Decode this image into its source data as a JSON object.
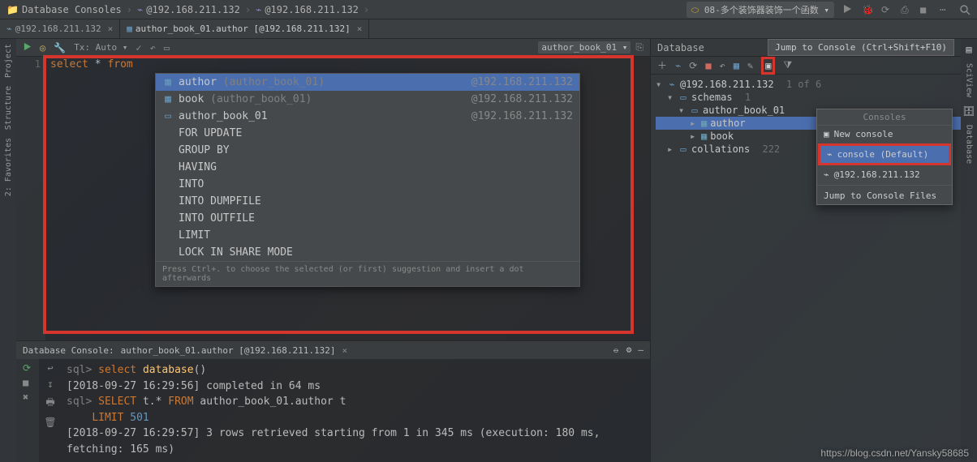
{
  "breadcrumbs": {
    "root": "Database Consoles",
    "item1": "@192.168.211.132",
    "item2": "@192.168.211.132"
  },
  "runConfig": "08-多个装饰器装饰一个函数",
  "tabs": {
    "tab1": "@192.168.211.132",
    "tab2": "author_book_01.author [@192.168.211.132]"
  },
  "editorToolbar": {
    "txMode": "Tx: Auto",
    "schema": "author_book_01"
  },
  "editor": {
    "lineNum": "1",
    "code": {
      "select": "select",
      "star": "*",
      "from": "from"
    }
  },
  "completion": {
    "rows": [
      {
        "label": "author",
        "dim": "(author_book_01)",
        "right": "@192.168.211.132",
        "icon": "▦"
      },
      {
        "label": "book",
        "dim": "(author_book_01)",
        "right": "@192.168.211.132",
        "icon": "▦"
      },
      {
        "label": "author_book_01",
        "dim": "",
        "right": "@192.168.211.132",
        "icon": "▭"
      },
      {
        "label": "FOR UPDATE",
        "dim": "",
        "right": "",
        "icon": ""
      },
      {
        "label": "GROUP BY",
        "dim": "",
        "right": "",
        "icon": ""
      },
      {
        "label": "HAVING",
        "dim": "",
        "right": "",
        "icon": ""
      },
      {
        "label": "INTO",
        "dim": "",
        "right": "",
        "icon": ""
      },
      {
        "label": "INTO DUMPFILE",
        "dim": "",
        "right": "",
        "icon": ""
      },
      {
        "label": "INTO OUTFILE",
        "dim": "",
        "right": "",
        "icon": ""
      },
      {
        "label": "LIMIT",
        "dim": "",
        "right": "",
        "icon": ""
      },
      {
        "label": "LOCK IN SHARE MODE",
        "dim": "",
        "right": "",
        "icon": ""
      }
    ],
    "footer": "Press Ctrl+. to choose the selected (or first) suggestion and insert a dot afterwards"
  },
  "console": {
    "title": "Database Console:",
    "tab": "author_book_01.author [@192.168.211.132]",
    "lines": {
      "p1_prompt": "sql>",
      "p1_kw": "select",
      "p1_fn": "database",
      "p1_paren": "()",
      "l2": "[2018-09-27 16:29:56] completed in 64 ms",
      "p2_prompt": "sql>",
      "p2_kw1": "SELECT",
      "p2_t": "t.*",
      "p2_kw2": "FROM",
      "p2_tbl": "author_book_01.author t",
      "p3_kw": "LIMIT",
      "p3_num": "501",
      "l5": "[2018-09-27 16:29:57] 3 rows retrieved starting from 1 in 345 ms (execution: 180 ms, fetching: 165 ms)"
    }
  },
  "db": {
    "title": "Database",
    "tooltip": "Jump to Console (Ctrl+Shift+F10)",
    "tree": {
      "conn": "@192.168.211.132",
      "connMeta": "1 of 6",
      "schemas": "schemas",
      "schemasCount": "1",
      "schema": "author_book_01",
      "author": "author",
      "book": "book",
      "collations": "collations",
      "collationsCount": "222"
    }
  },
  "consolesPopup": {
    "head": "Consoles",
    "new": "New console",
    "default": "console (Default)",
    "ip": "@192.168.211.132",
    "jump": "Jump to Console Files"
  },
  "sideTabs": {
    "project": "Project",
    "structure": "Structure",
    "favorites": "2: Favorites",
    "sciview": "SciView",
    "database": "Database"
  },
  "watermark": "https://blog.csdn.net/Yansky58685"
}
